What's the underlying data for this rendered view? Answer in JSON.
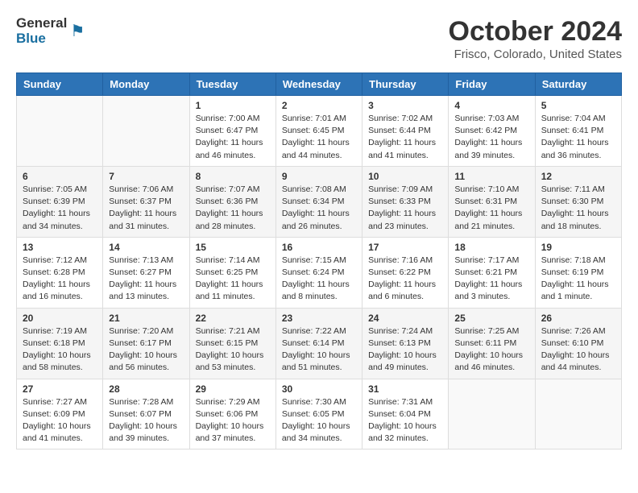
{
  "logo": {
    "general": "General",
    "blue": "Blue"
  },
  "title": "October 2024",
  "subtitle": "Frisco, Colorado, United States",
  "days_of_week": [
    "Sunday",
    "Monday",
    "Tuesday",
    "Wednesday",
    "Thursday",
    "Friday",
    "Saturday"
  ],
  "weeks": [
    [
      {
        "day": "",
        "info": ""
      },
      {
        "day": "",
        "info": ""
      },
      {
        "day": "1",
        "info": "Sunrise: 7:00 AM\nSunset: 6:47 PM\nDaylight: 11 hours and 46 minutes."
      },
      {
        "day": "2",
        "info": "Sunrise: 7:01 AM\nSunset: 6:45 PM\nDaylight: 11 hours and 44 minutes."
      },
      {
        "day": "3",
        "info": "Sunrise: 7:02 AM\nSunset: 6:44 PM\nDaylight: 11 hours and 41 minutes."
      },
      {
        "day": "4",
        "info": "Sunrise: 7:03 AM\nSunset: 6:42 PM\nDaylight: 11 hours and 39 minutes."
      },
      {
        "day": "5",
        "info": "Sunrise: 7:04 AM\nSunset: 6:41 PM\nDaylight: 11 hours and 36 minutes."
      }
    ],
    [
      {
        "day": "6",
        "info": "Sunrise: 7:05 AM\nSunset: 6:39 PM\nDaylight: 11 hours and 34 minutes."
      },
      {
        "day": "7",
        "info": "Sunrise: 7:06 AM\nSunset: 6:37 PM\nDaylight: 11 hours and 31 minutes."
      },
      {
        "day": "8",
        "info": "Sunrise: 7:07 AM\nSunset: 6:36 PM\nDaylight: 11 hours and 28 minutes."
      },
      {
        "day": "9",
        "info": "Sunrise: 7:08 AM\nSunset: 6:34 PM\nDaylight: 11 hours and 26 minutes."
      },
      {
        "day": "10",
        "info": "Sunrise: 7:09 AM\nSunset: 6:33 PM\nDaylight: 11 hours and 23 minutes."
      },
      {
        "day": "11",
        "info": "Sunrise: 7:10 AM\nSunset: 6:31 PM\nDaylight: 11 hours and 21 minutes."
      },
      {
        "day": "12",
        "info": "Sunrise: 7:11 AM\nSunset: 6:30 PM\nDaylight: 11 hours and 18 minutes."
      }
    ],
    [
      {
        "day": "13",
        "info": "Sunrise: 7:12 AM\nSunset: 6:28 PM\nDaylight: 11 hours and 16 minutes."
      },
      {
        "day": "14",
        "info": "Sunrise: 7:13 AM\nSunset: 6:27 PM\nDaylight: 11 hours and 13 minutes."
      },
      {
        "day": "15",
        "info": "Sunrise: 7:14 AM\nSunset: 6:25 PM\nDaylight: 11 hours and 11 minutes."
      },
      {
        "day": "16",
        "info": "Sunrise: 7:15 AM\nSunset: 6:24 PM\nDaylight: 11 hours and 8 minutes."
      },
      {
        "day": "17",
        "info": "Sunrise: 7:16 AM\nSunset: 6:22 PM\nDaylight: 11 hours and 6 minutes."
      },
      {
        "day": "18",
        "info": "Sunrise: 7:17 AM\nSunset: 6:21 PM\nDaylight: 11 hours and 3 minutes."
      },
      {
        "day": "19",
        "info": "Sunrise: 7:18 AM\nSunset: 6:19 PM\nDaylight: 11 hours and 1 minute."
      }
    ],
    [
      {
        "day": "20",
        "info": "Sunrise: 7:19 AM\nSunset: 6:18 PM\nDaylight: 10 hours and 58 minutes."
      },
      {
        "day": "21",
        "info": "Sunrise: 7:20 AM\nSunset: 6:17 PM\nDaylight: 10 hours and 56 minutes."
      },
      {
        "day": "22",
        "info": "Sunrise: 7:21 AM\nSunset: 6:15 PM\nDaylight: 10 hours and 53 minutes."
      },
      {
        "day": "23",
        "info": "Sunrise: 7:22 AM\nSunset: 6:14 PM\nDaylight: 10 hours and 51 minutes."
      },
      {
        "day": "24",
        "info": "Sunrise: 7:24 AM\nSunset: 6:13 PM\nDaylight: 10 hours and 49 minutes."
      },
      {
        "day": "25",
        "info": "Sunrise: 7:25 AM\nSunset: 6:11 PM\nDaylight: 10 hours and 46 minutes."
      },
      {
        "day": "26",
        "info": "Sunrise: 7:26 AM\nSunset: 6:10 PM\nDaylight: 10 hours and 44 minutes."
      }
    ],
    [
      {
        "day": "27",
        "info": "Sunrise: 7:27 AM\nSunset: 6:09 PM\nDaylight: 10 hours and 41 minutes."
      },
      {
        "day": "28",
        "info": "Sunrise: 7:28 AM\nSunset: 6:07 PM\nDaylight: 10 hours and 39 minutes."
      },
      {
        "day": "29",
        "info": "Sunrise: 7:29 AM\nSunset: 6:06 PM\nDaylight: 10 hours and 37 minutes."
      },
      {
        "day": "30",
        "info": "Sunrise: 7:30 AM\nSunset: 6:05 PM\nDaylight: 10 hours and 34 minutes."
      },
      {
        "day": "31",
        "info": "Sunrise: 7:31 AM\nSunset: 6:04 PM\nDaylight: 10 hours and 32 minutes."
      },
      {
        "day": "",
        "info": ""
      },
      {
        "day": "",
        "info": ""
      }
    ]
  ]
}
